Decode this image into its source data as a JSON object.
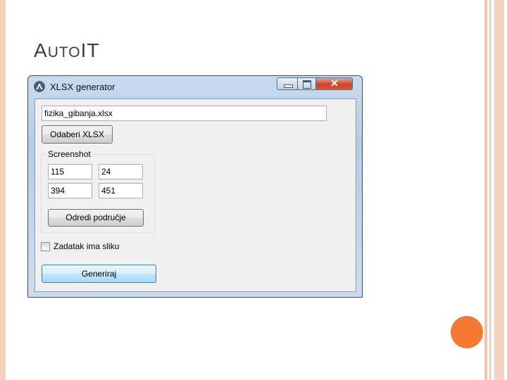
{
  "slide": {
    "title_first": "A",
    "title_small": "UTO",
    "title_last": "IT"
  },
  "window": {
    "title": "XLSX generator",
    "close_label": "✕",
    "file_input_value": "fizika_gibanja.xlsx",
    "choose_button_label": "Odaberi XLSX",
    "screenshot_group": {
      "legend": "Screenshot",
      "values": [
        "115",
        "24",
        "394",
        "451"
      ],
      "define_area_button_label": "Odredi područje"
    },
    "has_image_checkbox": {
      "label": "Zadatak ima sliku",
      "checked": false
    },
    "generate_button_label": "Generiraj"
  },
  "colors": {
    "accent_orange": "#f47a33",
    "border_peach": "#f6c3ab"
  }
}
